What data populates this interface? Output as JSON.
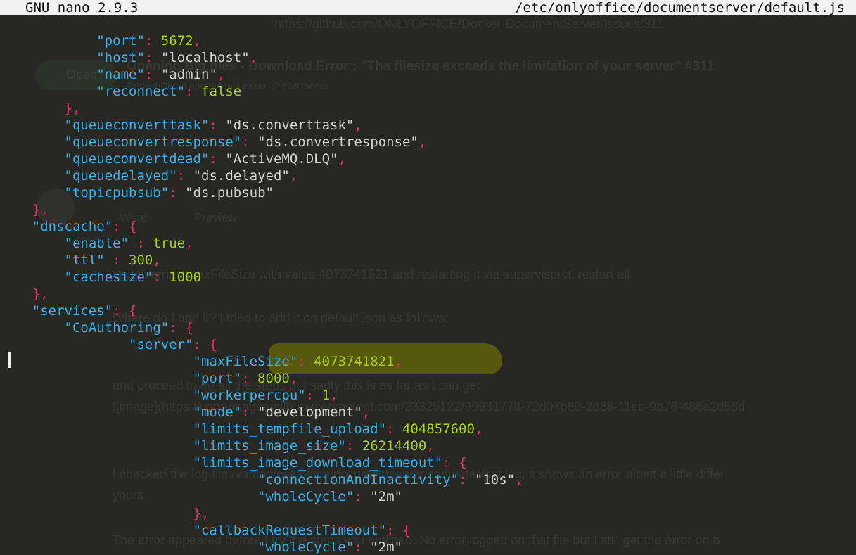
{
  "titlebar": {
    "app": "GNU nano 2.9.3",
    "file": "/etc/onlyoffice/documentserver/default.js"
  },
  "ghost": {
    "url": "https://github.com/ONLYOFFICE/Docker-DocumentServer/issues/311",
    "open": "Open",
    "issue_title": "Opening Big files - Download Error : \"The filesize exceeds the limitation of your server\" #311",
    "meta": "RedeshDhani opened this issue · 2 comments",
    "tab_write": "Write",
    "tab_preview": "Preview",
    "p1": "and override maxFileSize with value 4073741821 and restarting it via supervisorctl restart all",
    "p2": "Where do I add it? I tried to add it on default.json as follows:",
    "p3": "and proceed to do all the steps but sadly this is as far as I can get",
    "p4": "![image](https://user-images.githubusercontent.com/23325122/99931778-72d07b80-2d88-11eb-9b76-486a2d58d",
    "p5": "I checked the log file /var/log/onlyoffice/documentserver/converter/out.log, it shows an error albeit a little differ",
    "p6": "yours.",
    "p7": "The error appeared before I try the steps you outlined. No error logged on that file but I still get the error on b"
  },
  "lines": [
    [
      [
        "w",
        "            "
      ],
      [
        "k",
        "\"port\""
      ],
      [
        "p",
        ": "
      ],
      [
        "n",
        "5672"
      ],
      [
        "p",
        ","
      ]
    ],
    [
      [
        "w",
        "            "
      ],
      [
        "k",
        "\"host\""
      ],
      [
        "p",
        ": "
      ],
      [
        "s",
        "\"localhost\""
      ],
      [
        "p",
        ","
      ]
    ],
    [
      [
        "w",
        "            "
      ],
      [
        "k",
        "\"name\""
      ],
      [
        "p",
        ": "
      ],
      [
        "s",
        "\"admin\""
      ],
      [
        "p",
        ","
      ]
    ],
    [
      [
        "w",
        "            "
      ],
      [
        "k",
        "\"reconnect\""
      ],
      [
        "p",
        ": "
      ],
      [
        "b",
        "false"
      ]
    ],
    [
      [
        "w",
        "        "
      ],
      [
        "p",
        "},"
      ]
    ],
    [
      [
        "w",
        "        "
      ],
      [
        "k",
        "\"queueconverttask\""
      ],
      [
        "p",
        ": "
      ],
      [
        "s",
        "\"ds.converttask\""
      ],
      [
        "p",
        ","
      ]
    ],
    [
      [
        "w",
        "        "
      ],
      [
        "k",
        "\"queueconvertresponse\""
      ],
      [
        "p",
        ": "
      ],
      [
        "s",
        "\"ds.convertresponse\""
      ],
      [
        "p",
        ","
      ]
    ],
    [
      [
        "w",
        "        "
      ],
      [
        "k",
        "\"queueconvertdead\""
      ],
      [
        "p",
        ": "
      ],
      [
        "s",
        "\"ActiveMQ.DLQ\""
      ],
      [
        "p",
        ","
      ]
    ],
    [
      [
        "w",
        "        "
      ],
      [
        "k",
        "\"queuedelayed\""
      ],
      [
        "p",
        ": "
      ],
      [
        "s",
        "\"ds.delayed\""
      ],
      [
        "p",
        ","
      ]
    ],
    [
      [
        "w",
        "        "
      ],
      [
        "k",
        "\"topicpubsub\""
      ],
      [
        "p",
        ": "
      ],
      [
        "s",
        "\"ds.pubsub\""
      ]
    ],
    [
      [
        "w",
        "    "
      ],
      [
        "p",
        "},"
      ]
    ],
    [
      [
        "w",
        "    "
      ],
      [
        "k",
        "\"dnscache\""
      ],
      [
        "p",
        ": {"
      ]
    ],
    [
      [
        "w",
        "        "
      ],
      [
        "k",
        "\"enable\""
      ],
      [
        "p",
        " : "
      ],
      [
        "b",
        "true"
      ],
      [
        "p",
        ","
      ]
    ],
    [
      [
        "w",
        "        "
      ],
      [
        "k",
        "\"ttl\""
      ],
      [
        "p",
        " : "
      ],
      [
        "n",
        "300"
      ],
      [
        "p",
        ","
      ]
    ],
    [
      [
        "w",
        "        "
      ],
      [
        "k",
        "\"cachesize\""
      ],
      [
        "p",
        ": "
      ],
      [
        "n",
        "1000"
      ]
    ],
    [
      [
        "w",
        "    "
      ],
      [
        "p",
        "},"
      ]
    ],
    [
      [
        "w",
        "    "
      ],
      [
        "k",
        "\"services\""
      ],
      [
        "p",
        ": {"
      ]
    ],
    [
      [
        "w",
        "        "
      ],
      [
        "k",
        "\"CoAuthoring\""
      ],
      [
        "p",
        ": {"
      ]
    ],
    [
      [
        "w",
        "                "
      ],
      [
        "k",
        "\"server\""
      ],
      [
        "p",
        ": {"
      ]
    ],
    [
      [
        "w",
        "                        "
      ],
      [
        "k",
        "\"maxFileSize\""
      ],
      [
        "p",
        ": "
      ],
      [
        "n",
        "4073741821"
      ],
      [
        "p",
        ","
      ]
    ],
    [
      [
        "w",
        "                        "
      ],
      [
        "k",
        "\"port\""
      ],
      [
        "p",
        ": "
      ],
      [
        "n",
        "8000"
      ],
      [
        "p",
        ","
      ]
    ],
    [
      [
        "w",
        "                        "
      ],
      [
        "k",
        "\"workerpercpu\""
      ],
      [
        "p",
        ": "
      ],
      [
        "n",
        "1"
      ],
      [
        "p",
        ","
      ]
    ],
    [
      [
        "w",
        "                        "
      ],
      [
        "k",
        "\"mode\""
      ],
      [
        "p",
        ": "
      ],
      [
        "s",
        "\"development\""
      ],
      [
        "p",
        ","
      ]
    ],
    [
      [
        "w",
        "                        "
      ],
      [
        "k",
        "\"limits_tempfile_upload\""
      ],
      [
        "p",
        ": "
      ],
      [
        "n",
        "404857600"
      ],
      [
        "p",
        ","
      ]
    ],
    [
      [
        "w",
        "                        "
      ],
      [
        "k",
        "\"limits_image_size\""
      ],
      [
        "p",
        ": "
      ],
      [
        "n",
        "26214400"
      ],
      [
        "p",
        ","
      ]
    ],
    [
      [
        "w",
        "                        "
      ],
      [
        "k",
        "\"limits_image_download_timeout\""
      ],
      [
        "p",
        ": {"
      ]
    ],
    [
      [
        "w",
        "                                "
      ],
      [
        "k",
        "\"connectionAndInactivity\""
      ],
      [
        "p",
        ": "
      ],
      [
        "s",
        "\"10s\""
      ],
      [
        "p",
        ","
      ]
    ],
    [
      [
        "w",
        "                                "
      ],
      [
        "k",
        "\"wholeCycle\""
      ],
      [
        "p",
        ": "
      ],
      [
        "s",
        "\"2m\""
      ]
    ],
    [
      [
        "w",
        "                        "
      ],
      [
        "p",
        "},"
      ]
    ],
    [
      [
        "w",
        "                        "
      ],
      [
        "k",
        "\"callbackRequestTimeout\""
      ],
      [
        "p",
        ": {"
      ]
    ],
    [
      [
        "w",
        "                                "
      ],
      [
        "k",
        "\"wholeCycle\""
      ],
      [
        "p",
        ": "
      ],
      [
        "s",
        "\"2m\""
      ]
    ]
  ]
}
